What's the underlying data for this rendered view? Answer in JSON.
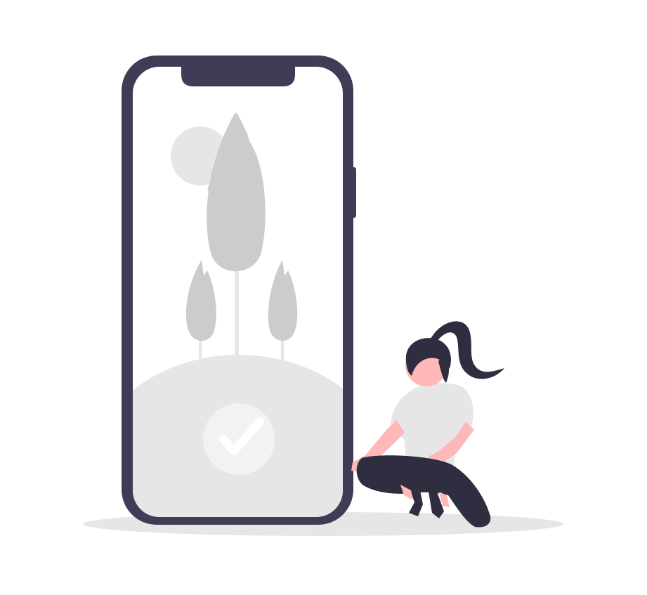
{
  "scene": {
    "description_icons": [
      "phone-frame",
      "tree-icon",
      "sun-icon",
      "hill",
      "checkmark-icon",
      "woman-figure",
      "ground-shadow"
    ],
    "status": "confirmed"
  },
  "colors": {
    "background": "#ffffff",
    "phone_frame": "#3f3d56",
    "screen": "#ffffff",
    "tree": "#cccccc",
    "sun": "#e6e6e6",
    "hill": "#e6e6e6",
    "check_circle": "#f2f2f2",
    "checkmark": "#ffffff",
    "shadow": "#e6e6e6",
    "hair": "#2f2e41",
    "skin": "#ffb8b8",
    "shirt": "#e6e6e6",
    "pants": "#2f2e41"
  }
}
